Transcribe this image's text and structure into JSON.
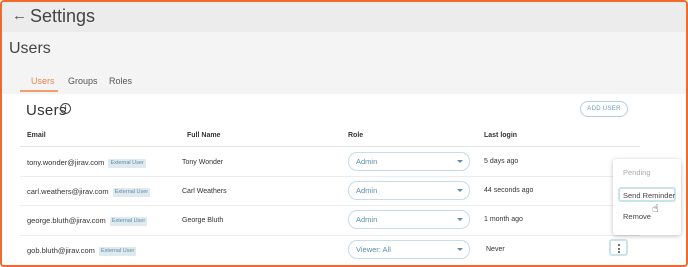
{
  "app": {
    "title": "Settings"
  },
  "page": {
    "title": "Users"
  },
  "tabs": [
    {
      "label": "Users",
      "active": true
    },
    {
      "label": "Groups",
      "active": false
    },
    {
      "label": "Roles",
      "active": false
    }
  ],
  "section": {
    "title": "Users",
    "add_button": "ADD USER"
  },
  "table": {
    "headers": {
      "email": "Email",
      "full_name": "Full Name",
      "role": "Role",
      "last_login": "Last login"
    },
    "rows": [
      {
        "email": "tony.wonder@jirav.com",
        "badge": "External User",
        "full_name": "Tony Wonder",
        "role": "Admin",
        "last_login": "5 days ago"
      },
      {
        "email": "carl.weathers@jirav.com",
        "badge": "External User",
        "full_name": "Carl Weathers",
        "role": "Admin",
        "last_login": "44 seconds ago"
      },
      {
        "email": "george.bluth@jirav.com",
        "badge": "External User",
        "full_name": "George Bluth",
        "role": "Admin",
        "last_login": "1 month ago"
      },
      {
        "email": "gob.bluth@jirav.com",
        "badge": "External User",
        "full_name": "",
        "role": "Viewer: All",
        "last_login": "Never"
      }
    ]
  },
  "row_menu": {
    "items": [
      {
        "label": "Pending",
        "disabled": true
      },
      {
        "label": "Send Reminder",
        "disabled": false
      },
      {
        "label": "Remove",
        "disabled": false
      }
    ]
  },
  "colors": {
    "accent": "#f0a070",
    "link": "#5b8fae",
    "frame": "#f06a2e"
  }
}
